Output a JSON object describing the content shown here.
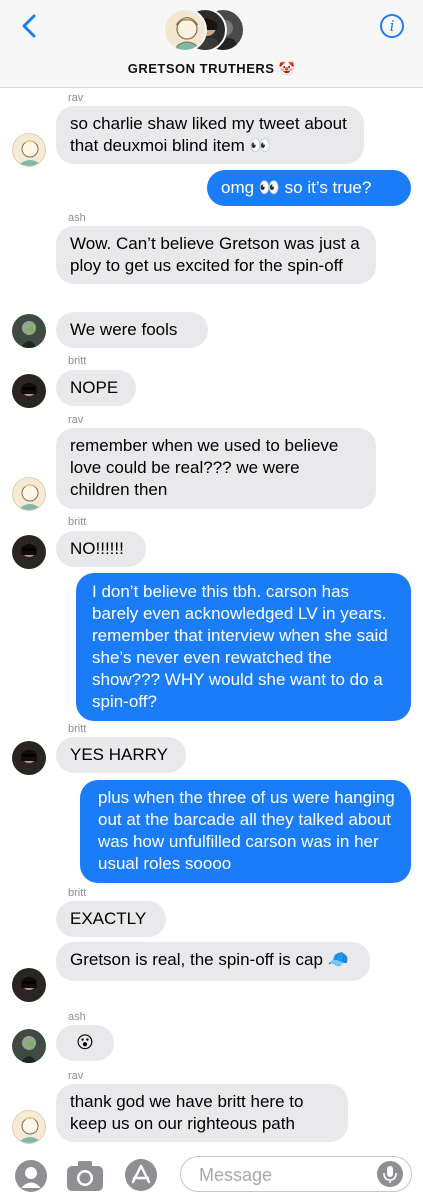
{
  "header": {
    "title": "GRETSON TRUTHERS",
    "title_emoji": "🤡",
    "accent": "#1e7cf6"
  },
  "messages": [
    {
      "sender": "rav",
      "text": "so charlie shaw liked my tweet about that deuxmoi blind item 👀",
      "dir": "in"
    },
    {
      "text": "omg 👀 so it’s true?",
      "dir": "out"
    },
    {
      "sender": "ash",
      "text": "Wow. Can’t believe Gretson was just a ploy to get us excited for the spin-off",
      "dir": "in"
    },
    {
      "text": "We were fools",
      "dir": "in"
    },
    {
      "sender": "britt",
      "text": "NOPE",
      "dir": "in"
    },
    {
      "sender": "rav",
      "text": "remember when we used to believe love could be real??? we were children then",
      "dir": "in"
    },
    {
      "sender": "britt",
      "text": "NO!!!!!!",
      "dir": "in"
    },
    {
      "text": "I don’t believe this tbh. carson has barely even acknowledged LV in years. remember that interview when she said she’s never even rewatched the show??? WHY would she want to do a spin-off?",
      "dir": "out"
    },
    {
      "sender": "britt",
      "text": "YES HARRY",
      "dir": "in"
    },
    {
      "text": "plus when the three of us were hanging out at the barcade all they talked about was how unfulfilled carson was in her usual roles soooo",
      "dir": "out"
    },
    {
      "sender": "britt",
      "text": "EXACTLY",
      "dir": "in"
    },
    {
      "text": "Gretson is real, the spin-off is cap 🧢",
      "dir": "in"
    },
    {
      "sender": "ash",
      "text": "😮",
      "dir": "in"
    },
    {
      "sender": "rav",
      "text": "thank god we have britt here to keep us on our righteous path",
      "dir": "in"
    }
  ],
  "composer": {
    "placeholder": "Message"
  },
  "colors": {
    "incoming_bubble": "#e9e9eb",
    "outgoing_bubble": "#1b7cf7"
  }
}
